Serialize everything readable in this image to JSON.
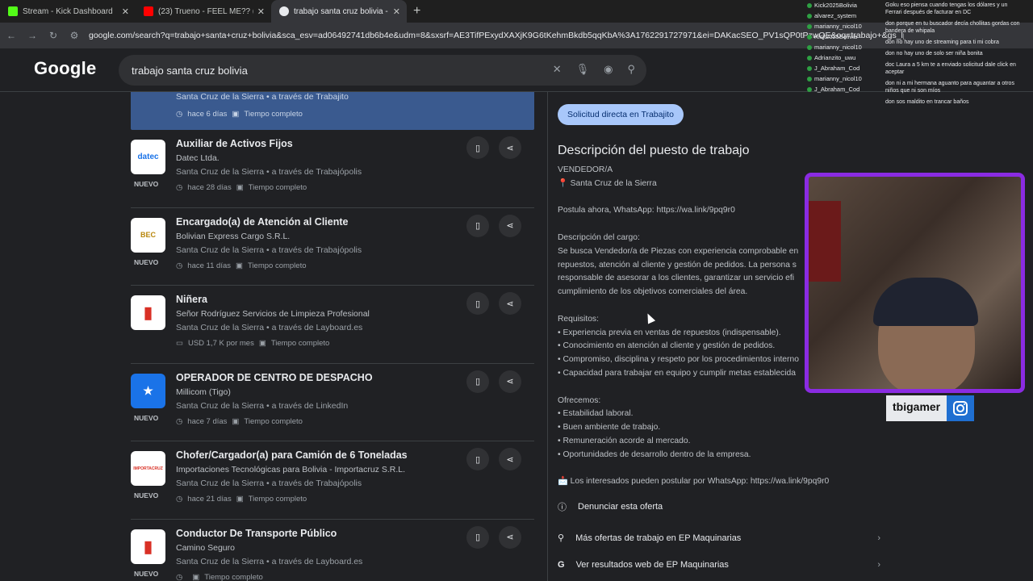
{
  "browser": {
    "tabs": [
      {
        "label": "Stream - Kick Dashboard",
        "icon": "kick-icon",
        "color": "#53fc18"
      },
      {
        "label": "(23) Trueno - FEEL ME?? (Vi",
        "icon": "youtube-icon",
        "color": "#ff0000"
      },
      {
        "label": "trabajo santa cruz bolivia - Bus",
        "icon": "google-icon",
        "color": "#e8eaed"
      }
    ],
    "url_domain": "google.com",
    "url_path": "/search?q=trabajo+santa+cruz+bolivia&sca_esv=ad06492741db6b4e&udm=8&sxsrf=AE3TifPExydXAXjK9G6tKehmBkdb5qqKbA%3A1762291727971&ei=DAKacSEO_PV1sQP0tPzwQE&oq=trabajo+&gs_lp=EhVnd3Mtd2l6LX"
  },
  "google": {
    "logo": "Google",
    "query": "trabajo santa cruz bolivia"
  },
  "selected_job": {
    "loc": "Santa Cruz de la Sierra • a través de Trabajito",
    "age": "hace 6 días",
    "type": "Tiempo completo"
  },
  "jobs": [
    {
      "title": "Auxiliar de Activos Fijos",
      "company": "Datec Ltda.",
      "loc": "Santa Cruz de la Sierra • a través de Trabajópolis",
      "age": "hace 28 días",
      "type": "Tiempo completo",
      "badge": "NUEVO",
      "logo_text": "datec"
    },
    {
      "title": "Encargado(a) de Atención al Cliente",
      "company": "Bolivian Express Cargo S.R.L.",
      "loc": "Santa Cruz de la Sierra • a través de Trabajópolis",
      "age": "hace 11 días",
      "type": "Tiempo completo",
      "badge": "NUEVO",
      "logo_text": "BEC"
    },
    {
      "title": "Niñera",
      "company": "Señor Rodríguez Servicios de Limpieza Profesional",
      "loc": "Santa Cruz de la Sierra • a través de Layboard.es",
      "age": "USD 1,7 K por mes",
      "type": "Tiempo completo",
      "badge": "",
      "logo_text": "▮"
    },
    {
      "title": "OPERADOR DE CENTRO DE DESPACHO",
      "company": "Millicom (Tigo)",
      "loc": "Santa Cruz de la Sierra • a través de LinkedIn",
      "age": "hace 7 días",
      "type": "Tiempo completo",
      "badge": "NUEVO",
      "logo_text": "★"
    },
    {
      "title": "Chofer/Cargador(a) para Camión de 6 Toneladas",
      "company": "Importaciones Tecnológicas para Bolivia - Importacruz S.R.L.",
      "loc": "Santa Cruz de la Sierra • a través de Trabajópolis",
      "age": "hace 21 días",
      "type": "Tiempo completo",
      "badge": "NUEVO",
      "logo_text": "IMPORTACRUZ"
    },
    {
      "title": "Conductor De Transporte Público",
      "company": "Camino Seguro",
      "loc": "Santa Cruz de la Sierra • a través de Layboard.es",
      "age": "",
      "type": "Tiempo completo",
      "badge": "NUEVO",
      "logo_text": "▮"
    }
  ],
  "detail": {
    "apply": "Solicitud directa en Trabajito",
    "title": "Descripción del puesto de trabajo",
    "body": "VENDEDOR/A\n📍 Santa Cruz de la Sierra\n\nPostula ahora, WhatsApp: https://wa.link/9pq9r0\n\nDescripción del cargo:\nSe busca Vendedor/a de Piezas con experiencia comprobable en\nrepuestos, atención al cliente y gestión de pedidos. La persona s\nresponsable de asesorar a los clientes, garantizar un servicio efi\ncumplimiento de los objetivos comerciales del área.\n\nRequisitos:\n• Experiencia previa en ventas de repuestos (indispensable).\n• Conocimiento en atención al cliente y gestión de pedidos.\n• Compromiso, disciplina y respeto por los procedimientos interno\n• Capacidad para trabajar en equipo y cumplir metas establecida\n\nOfrecemos:\n• Estabilidad laboral.\n• Buen ambiente de trabajo.\n• Remuneración acorde al mercado.\n• Oportunidades de desarrollo dentro de la empresa.\n\n📩 Los interesados pueden postular por WhatsApp: https://wa.link/9pq9r0",
    "report": "Denunciar esta oferta",
    "more_offers": "Más ofertas de trabajo en EP Maquinarias",
    "web_results": "Ver resultados web de EP Maquinarias"
  },
  "stream": {
    "users": [
      "Kick2025Bolivia",
      "alvarez_system",
      "marianny_nicol10",
      "Kick2025Bolivia",
      "marianny_nicol10",
      "Adrianzito_uwu",
      "J_Abraham_Cod",
      "marianny_nicol10",
      "J_Abraham_Cod"
    ],
    "messages": [
      "Goku eso piensa cuando tengas los dólares y un Ferrari después de facturar en DC",
      "don porque en tu buscador decía chollitas gordas con bandera de whipala",
      "don no hay uno de streaming para ti mi cobra",
      "don no hay uno de solo ser niña bonita",
      "doc Laura a 5 km te a enviado solicitud dale click en aceptar",
      "don ni a mi hermana aguanto para aguantar a otros niños que ni son míos",
      "don sos maldito en trancar baños"
    ],
    "streamer": "tbigamer",
    "frame_color": "#8a2be2"
  }
}
